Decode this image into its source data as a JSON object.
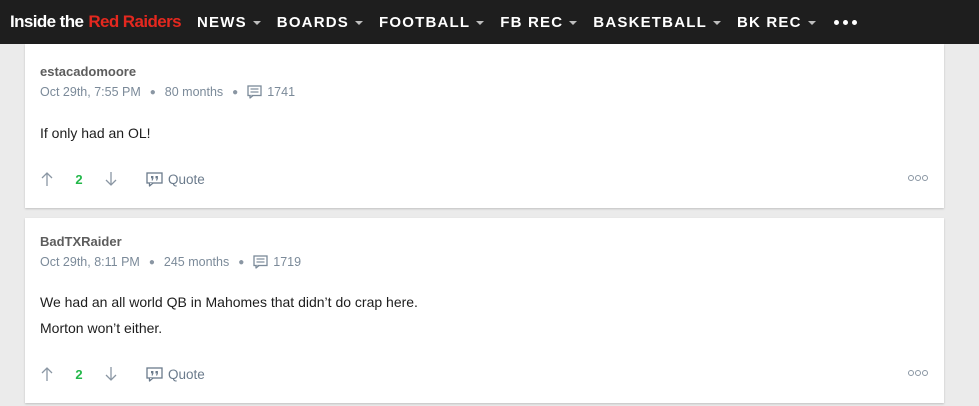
{
  "header": {
    "logo_part1": "Inside the",
    "logo_part2": "Red Raiders",
    "nav": [
      "NEWS",
      "BOARDS",
      "FOOTBALL",
      "FB REC",
      "BASKETBALL",
      "BK REC"
    ],
    "colors": {
      "bar": "#1e1e1e",
      "logo_accent": "#e4281f"
    }
  },
  "posts": [
    {
      "author": "estacadomoore",
      "date": "Oct 29th, 7:55 PM",
      "tenure": "80 months",
      "post_count": "1741",
      "lines": [
        "If only had an OL!"
      ],
      "score": "2",
      "quote_label": "Quote"
    },
    {
      "author": "BadTXRaider",
      "date": "Oct 29th, 8:11 PM",
      "tenure": "245 months",
      "post_count": "1719",
      "lines": [
        "We had an all world QB in Mahomes that didn’t do crap here.",
        "Morton won’t either."
      ],
      "score": "2",
      "quote_label": "Quote"
    }
  ]
}
